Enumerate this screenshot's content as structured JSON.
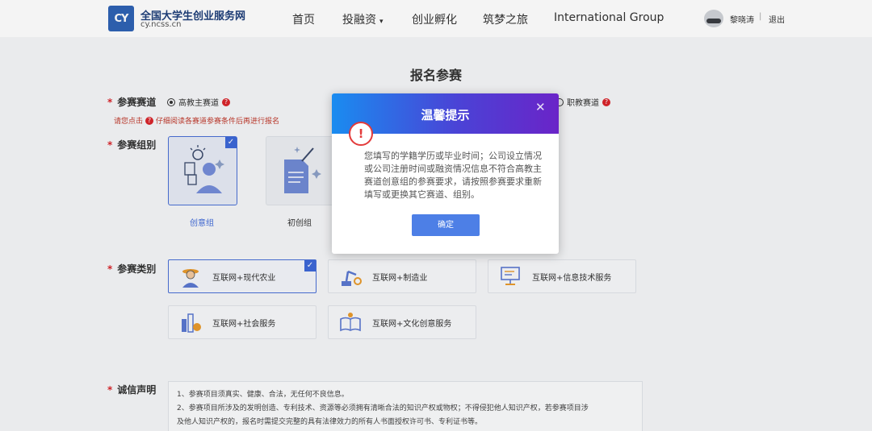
{
  "header": {
    "logo_mark": "CY",
    "site_title": "全国大学生创业服务网",
    "site_url": "cy.ncss.cn",
    "nav": [
      {
        "label": "首页"
      },
      {
        "label": "投融资"
      },
      {
        "label": "创业孵化"
      },
      {
        "label": "筑梦之旅"
      },
      {
        "label": "International Group"
      }
    ],
    "nav_caret": "▾",
    "user_name": "黎晓涛",
    "separator": "|",
    "logout": "退出"
  },
  "page": {
    "title": "报名参赛",
    "required_mark": "*",
    "track": {
      "label": "参赛赛道",
      "options": [
        {
          "label": "高教主赛道",
          "selected": true
        },
        {
          "label": "职教赛道",
          "selected": false
        }
      ],
      "hint_prefix": "请您点击",
      "hint_suffix": "仔细阅读各赛道参赛条件后再进行报名",
      "help_glyph": "?"
    },
    "group": {
      "label": "参赛组别",
      "items": [
        {
          "label": "创意组",
          "selected": true
        },
        {
          "label": "初创组",
          "selected": false
        }
      ]
    },
    "category": {
      "label": "参赛类别",
      "items": [
        {
          "label": "互联网+现代农业",
          "selected": true
        },
        {
          "label": "互联网+制造业",
          "selected": false
        },
        {
          "label": "互联网+信息技术服务",
          "selected": false
        },
        {
          "label": "互联网+社会服务",
          "selected": false
        },
        {
          "label": "互联网+文化创意服务",
          "selected": false
        }
      ]
    },
    "statement": {
      "label": "诚信声明",
      "lines": [
        "1、参赛项目须真实、健康、合法，无任何不良信息。",
        "2、参赛项目所涉及的发明创造、专利技术、资源等必须拥有清晰合法的知识产权或物权；不得侵犯他人知识产权，若参赛项目涉",
        "及他人知识产权的，报名时需提交完整的具有法律效力的所有人书面授权许可书、专利证书等。"
      ]
    },
    "check_glyph": "✓"
  },
  "modal": {
    "title": "温馨提示",
    "close_glyph": "✕",
    "warn_glyph": "!",
    "message": "您填写的学籍学历或毕业时间；公司设立情况或公司注册时间或融资情况信息不符合高教主赛道创意组的参赛要求，请按照参赛要求重新填写或更换其它赛道、组别。",
    "confirm_label": "确定"
  },
  "colors": {
    "accent": "#4d7fe6",
    "required": "#d9252b",
    "modal_gradient_start": "#1a8cf0",
    "modal_gradient_end": "#6a24c8"
  }
}
